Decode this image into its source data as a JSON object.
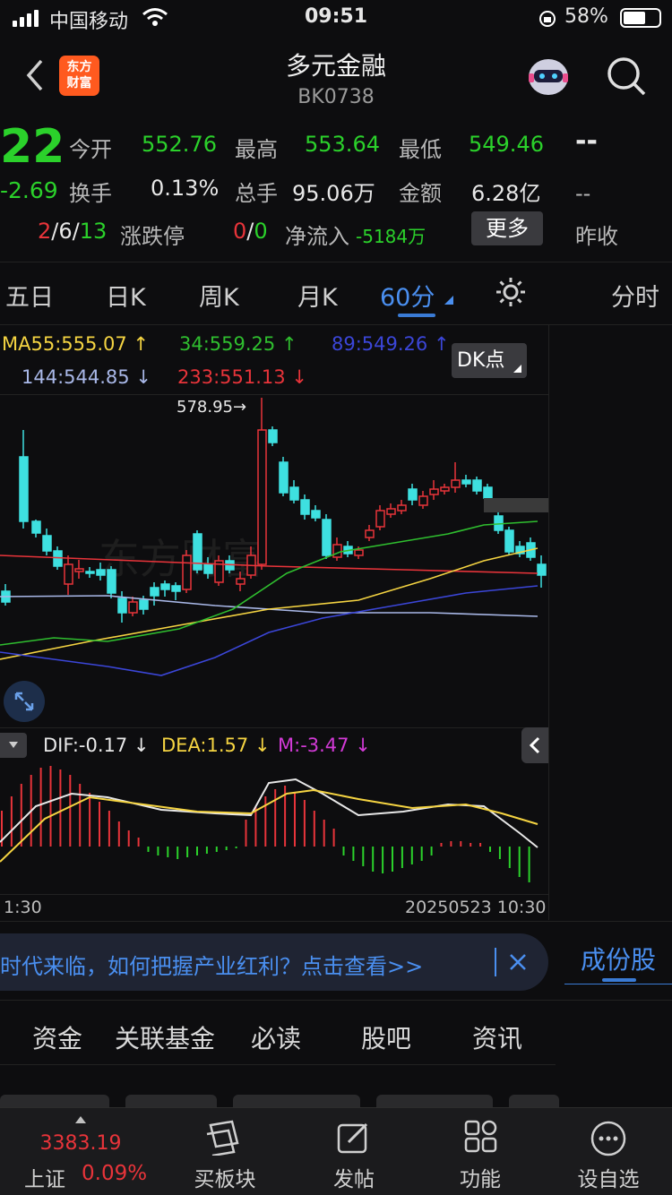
{
  "status": {
    "carrier": "中国移动",
    "time": "09:51",
    "battery": "58%"
  },
  "header": {
    "title": "多元金融",
    "code": "BK0738",
    "logo_line1": "东方",
    "logo_line2": "财富"
  },
  "quote": {
    "price": "22",
    "change": "-2.69",
    "open_label": "今开",
    "open": "552.76",
    "high_label": "最高",
    "high": "553.64",
    "low_label": "最低",
    "low": "549.46",
    "turnover_label": "换手",
    "turnover": "0.13%",
    "volume_label": "总手",
    "volume": "95.06万",
    "amount_label": "金额",
    "amount": "6.28亿",
    "adv_up": "2",
    "adv_flat": "6",
    "adv_down": "13",
    "limit_label": "涨跌停",
    "limit_up": "0",
    "limit_down": "0",
    "netflow_label": "净流入",
    "netflow": "-5184万",
    "more_label": "更多",
    "right_top": "--",
    "right_mid": "--",
    "prev_close_label": "昨收"
  },
  "tabs": [
    "五日",
    "日K",
    "周K",
    "月K",
    "60分",
    "分时"
  ],
  "ma": {
    "ma55": "MA55:555.07 ↑",
    "ma34": "34:559.25 ↑",
    "ma89": "89:549.26 ↑",
    "ma144": "144:544.85 ↓",
    "ma233": "233:551.13 ↓",
    "dk_label": "DK点"
  },
  "chart": {
    "high_marker": "578.95→",
    "watermark": "东方财富"
  },
  "macd": {
    "dif": "DIF:-0.17 ↓",
    "dea": "DEA:1.57 ↓",
    "m": "M:-3.47 ↓"
  },
  "axis": {
    "left_time": "1:30",
    "right_time": "20250523 10:30"
  },
  "banner": {
    "text": "时代来临，如何把握产业红利？点击查看>>",
    "side_tab": "成份股"
  },
  "bottom_tabs": [
    "资金",
    "关联基金",
    "必读",
    "股吧",
    "资讯"
  ],
  "nav": {
    "index_value": "3383.19",
    "index_name": "上证",
    "index_change": "0.09%",
    "items": [
      "买板块",
      "发帖",
      "功能",
      "设自选"
    ]
  },
  "colors": {
    "up": "#e8343a",
    "down": "#2bd12b",
    "candle_down": "#3ee0e0",
    "accent": "#3a7bd5"
  }
}
